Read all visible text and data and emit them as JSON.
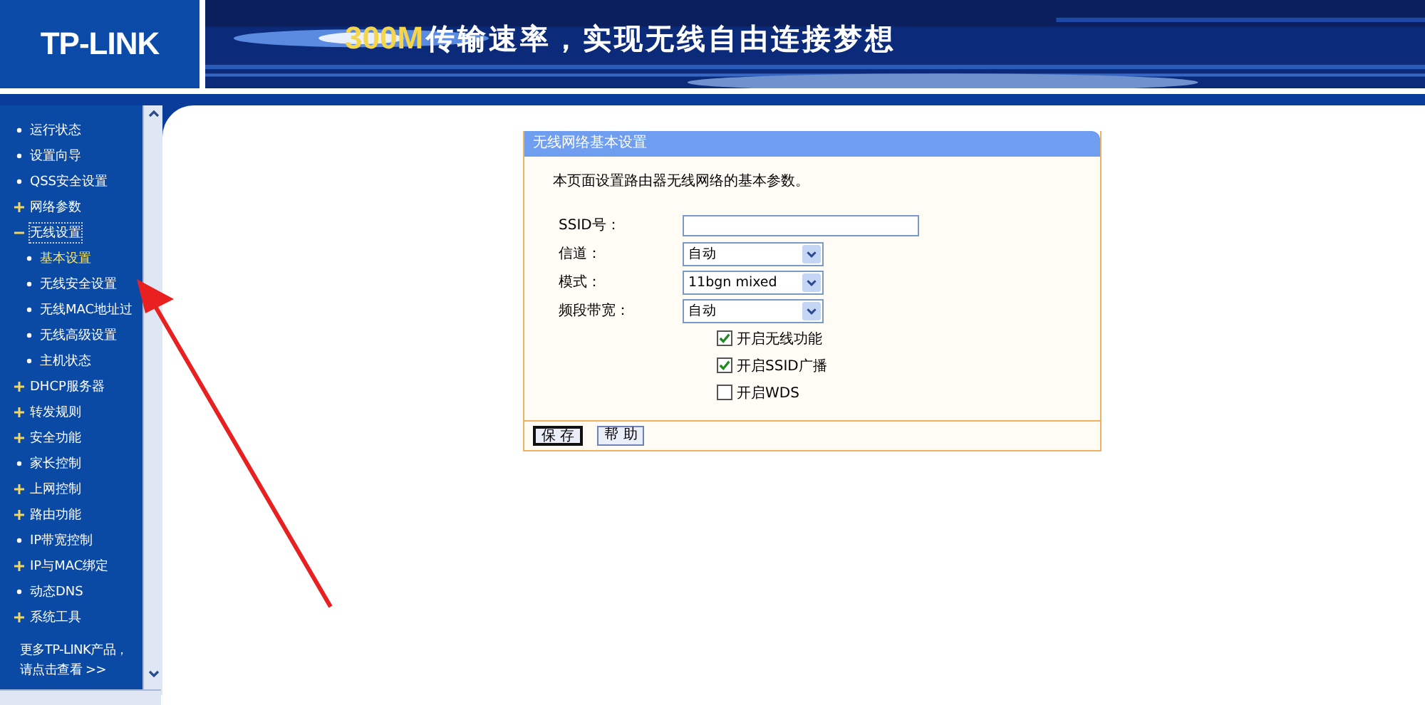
{
  "header": {
    "logo": "TP-LINK",
    "slogan_highlight": "300M",
    "slogan": "传输速率，实现无线自由连接梦想"
  },
  "sidebar": {
    "items": [
      {
        "label": "运行状态",
        "kind": "link",
        "selected": false
      },
      {
        "label": "设置向导",
        "kind": "link",
        "selected": false
      },
      {
        "label": "QSS安全设置",
        "kind": "link",
        "selected": false
      },
      {
        "label": "网络参数",
        "kind": "group",
        "expanded": false,
        "selected": false
      },
      {
        "label": "无线设置",
        "kind": "group",
        "expanded": true,
        "selected": false,
        "children": [
          {
            "label": "基本设置",
            "selected": true
          },
          {
            "label": "无线安全设置",
            "selected": false
          },
          {
            "label": "无线MAC地址过",
            "selected": false
          },
          {
            "label": "无线高级设置",
            "selected": false
          },
          {
            "label": "主机状态",
            "selected": false
          }
        ]
      },
      {
        "label": "DHCP服务器",
        "kind": "group",
        "expanded": false,
        "selected": false
      },
      {
        "label": "转发规则",
        "kind": "group",
        "expanded": false,
        "selected": false
      },
      {
        "label": "安全功能",
        "kind": "group",
        "expanded": false,
        "selected": false
      },
      {
        "label": "家长控制",
        "kind": "link",
        "selected": false
      },
      {
        "label": "上网控制",
        "kind": "group",
        "expanded": false,
        "selected": false
      },
      {
        "label": "路由功能",
        "kind": "group",
        "expanded": false,
        "selected": false
      },
      {
        "label": "IP带宽控制",
        "kind": "link",
        "selected": false
      },
      {
        "label": "IP与MAC绑定",
        "kind": "group",
        "expanded": false,
        "selected": false
      },
      {
        "label": "动态DNS",
        "kind": "link",
        "selected": false
      },
      {
        "label": "系统工具",
        "kind": "group",
        "expanded": false,
        "selected": false
      }
    ],
    "more_line1": "更多TP-LINK产品，",
    "more_line2": "请点击查看 >>"
  },
  "panel": {
    "title": "无线网络基本设置",
    "description": "本页面设置路由器无线网络的基本参数。",
    "fields": [
      {
        "label": "SSID号：",
        "kind": "text"
      },
      {
        "label": "信道：",
        "kind": "select",
        "value": "自动"
      },
      {
        "label": "模式：",
        "kind": "select",
        "value": "11bgn mixed"
      },
      {
        "label": "频段带宽：",
        "kind": "select",
        "value": "自动"
      }
    ],
    "checkboxes": [
      {
        "label": "开启无线功能",
        "checked": true
      },
      {
        "label": "开启SSID广播",
        "checked": true
      },
      {
        "label": "开启WDS",
        "checked": false
      }
    ],
    "buttons": [
      "保 存",
      "帮 助"
    ]
  }
}
